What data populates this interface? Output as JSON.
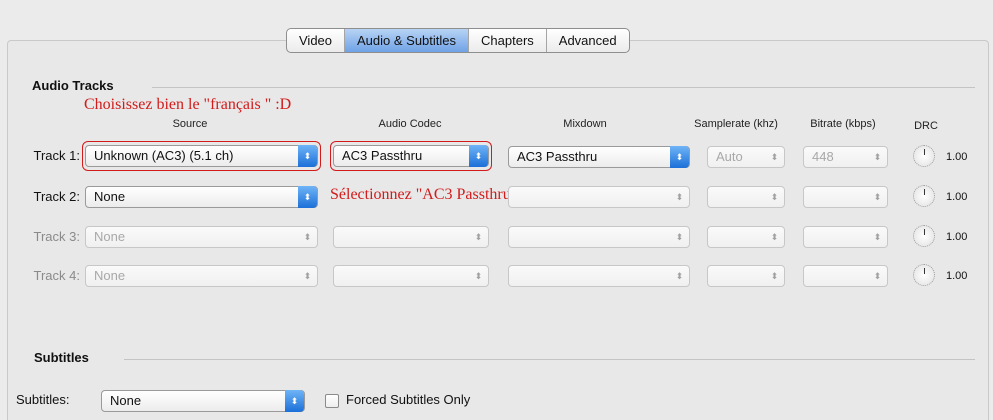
{
  "tabs": [
    "Video",
    "Audio & Subtitles",
    "Chapters",
    "Advanced"
  ],
  "active_tab": "Audio & Subtitles",
  "audio": {
    "title": "Audio Tracks",
    "columns": {
      "source": "Source",
      "codec": "Audio Codec",
      "mixdown": "Mixdown",
      "samplerate": "Samplerate (khz)",
      "bitrate": "Bitrate (kbps)",
      "drc": "DRC"
    },
    "tracks": [
      {
        "label": "Track 1:",
        "source": "Unknown (AC3) (5.1 ch)",
        "codec": "AC3 Passthru",
        "mixdown": "AC3 Passthru",
        "samplerate": "Auto",
        "bitrate": "448",
        "drc": "1.00"
      },
      {
        "label": "Track 2:",
        "source": "None",
        "codec": "",
        "mixdown": "",
        "samplerate": "",
        "bitrate": "",
        "drc": "1.00"
      },
      {
        "label": "Track 3:",
        "source": "None",
        "codec": "",
        "mixdown": "",
        "samplerate": "",
        "bitrate": "",
        "drc": "1.00"
      },
      {
        "label": "Track 4:",
        "source": "None",
        "codec": "",
        "mixdown": "",
        "samplerate": "",
        "bitrate": "",
        "drc": "1.00"
      }
    ]
  },
  "annotations": {
    "source_note": "Choisissez bien le \"français \" :D",
    "codec_note": "Sélectionnez \"AC3 Passthru"
  },
  "subtitles": {
    "title": "Subtitles",
    "label": "Subtitles:",
    "value": "None",
    "forced_label": "Forced Subtitles Only"
  }
}
